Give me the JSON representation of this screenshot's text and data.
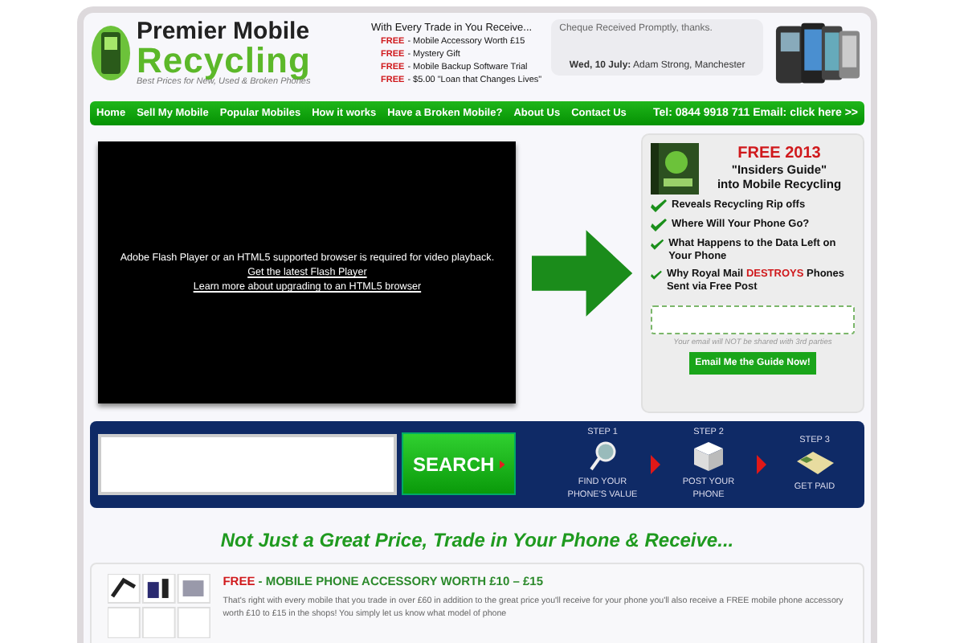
{
  "logo": {
    "line1": "Premier Mobile",
    "line2": "Recycling",
    "tagline": "Best Prices for New, Used & Broken Phones"
  },
  "promo": {
    "heading": "With Every Trade in You Receive...",
    "items": [
      {
        "label": "FREE",
        "text": "- Mobile Accessory Worth  £15"
      },
      {
        "label": "FREE",
        "text": "- Mystery Gift"
      },
      {
        "label": "FREE",
        "text": "- Mobile Backup Software Trial"
      },
      {
        "label": "FREE",
        "text": "- $5.00 \"Loan that Changes Lives\""
      }
    ]
  },
  "testimonial": {
    "quote": "Cheque Received Promptly, thanks.",
    "date": "Wed, 10 July:",
    "author": "Adam Strong, Manchester"
  },
  "nav": {
    "items": [
      "Home",
      "Sell My Mobile",
      "Popular Mobiles",
      "How it works",
      "Have a Broken Mobile?",
      "About Us",
      "Contact Us"
    ],
    "contact": "Tel: 0844 9918 711 Email: click here >>"
  },
  "video": {
    "message": "Adobe Flash Player or an HTML5 supported browser is required for video playback.",
    "links": [
      "Get the latest Flash Player",
      "Learn more about upgrading to an HTML5 browser"
    ]
  },
  "guide": {
    "title": "FREE 2013",
    "subtitle": "\"Insiders Guide\"",
    "subtitle2": "into Mobile Recycling",
    "bullets": [
      {
        "text": "Reveals Recycling Rip offs"
      },
      {
        "text": "Where Will Your Phone Go?"
      },
      {
        "text": "What Happens to the Data Left on Your Phone"
      },
      {
        "text": "Why Royal Mail",
        "highlight": "DESTROYS",
        "rest": "Phones Sent via Free Post"
      }
    ],
    "note": "Your email will NOT be shared with 3rd parties",
    "button": "Email Me the Guide Now!"
  },
  "search": {
    "button": "SEARCH",
    "steps": [
      {
        "kind": "search",
        "label": "STEP 1",
        "caption": "FIND YOUR PHONE'S VALUE"
      },
      {
        "kind": "box",
        "label": "STEP 2",
        "caption": "POST YOUR PHONE"
      },
      {
        "kind": "cheque",
        "label": "STEP 3",
        "caption": "GET PAID"
      }
    ]
  },
  "heading": "Not Just a Great Price, Trade in Your Phone & Receive...",
  "accessory": {
    "label": "FREE",
    "title": "- MOBILE PHONE ACCESSORY WORTH £10 – £15",
    "text": "That's right with every mobile that you trade in over £60 in addition to the great price you'll receive for your phone you'll also receive a FREE mobile phone accessory worth £10 to £15 in the shops! You simply let us know what model of phone"
  }
}
